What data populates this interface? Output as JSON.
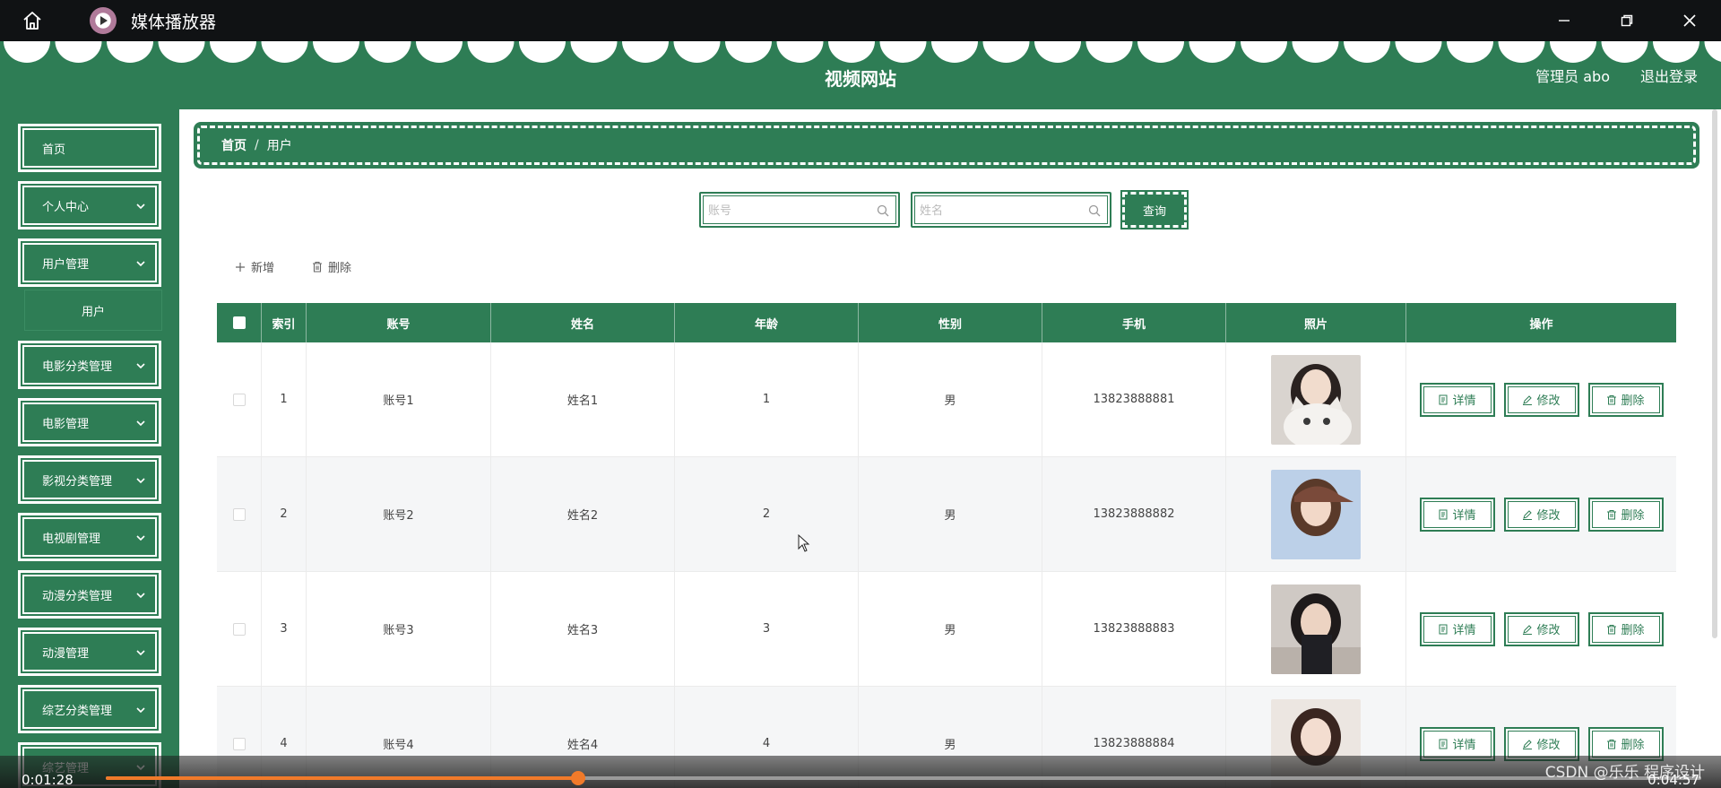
{
  "player": {
    "app_title": "媒体播放器",
    "current_time": "0:01:28",
    "total_time": "0:04:57",
    "progress": 0.2963,
    "watermark": "CSDN @乐乐 程序设计",
    "accent": "#f07a2a"
  },
  "header": {
    "site_title": "视频网站",
    "user_label": "管理员 abo",
    "logout_label": "退出登录",
    "brand_color": "#2e7d55"
  },
  "sidebar": {
    "items": [
      {
        "label": "首页",
        "has_arrow": false
      },
      {
        "label": "个人中心",
        "has_arrow": true
      },
      {
        "label": "用户管理",
        "has_arrow": true
      },
      {
        "label": "电影分类管理",
        "has_arrow": true
      },
      {
        "label": "电影管理",
        "has_arrow": true
      },
      {
        "label": "影视分类管理",
        "has_arrow": true
      },
      {
        "label": "电视剧管理",
        "has_arrow": true
      },
      {
        "label": "动漫分类管理",
        "has_arrow": true
      },
      {
        "label": "动漫管理",
        "has_arrow": true
      },
      {
        "label": "综艺分类管理",
        "has_arrow": true
      },
      {
        "label": "综艺管理",
        "has_arrow": true
      }
    ],
    "submenu": {
      "label": "用户"
    }
  },
  "breadcrumb": {
    "home": "首页",
    "separator": "/",
    "current": "用户"
  },
  "search": {
    "account_placeholder": "账号",
    "name_placeholder": "姓名",
    "query_label": "查询"
  },
  "actions": {
    "add_label": "新增",
    "delete_label": "删除"
  },
  "table": {
    "headers": [
      "索引",
      "账号",
      "姓名",
      "年龄",
      "性别",
      "手机",
      "照片",
      "操作"
    ],
    "rows": [
      {
        "index": "1",
        "account": "账号1",
        "name": "姓名1",
        "age": "1",
        "gender": "男",
        "phone": "13823888881",
        "photo": "girl-with-cat"
      },
      {
        "index": "2",
        "account": "账号2",
        "name": "姓名2",
        "age": "2",
        "gender": "男",
        "phone": "13823888882",
        "photo": "girl-with-cap"
      },
      {
        "index": "3",
        "account": "账号3",
        "name": "姓名3",
        "age": "3",
        "gender": "男",
        "phone": "13823888883",
        "photo": "girl-on-stairs"
      },
      {
        "index": "4",
        "account": "账号4",
        "name": "姓名4",
        "age": "4",
        "gender": "男",
        "phone": "13823888884",
        "photo": "girl-portrait"
      }
    ],
    "op_labels": {
      "detail": "详情",
      "edit": "修改",
      "delete": "删除"
    }
  }
}
